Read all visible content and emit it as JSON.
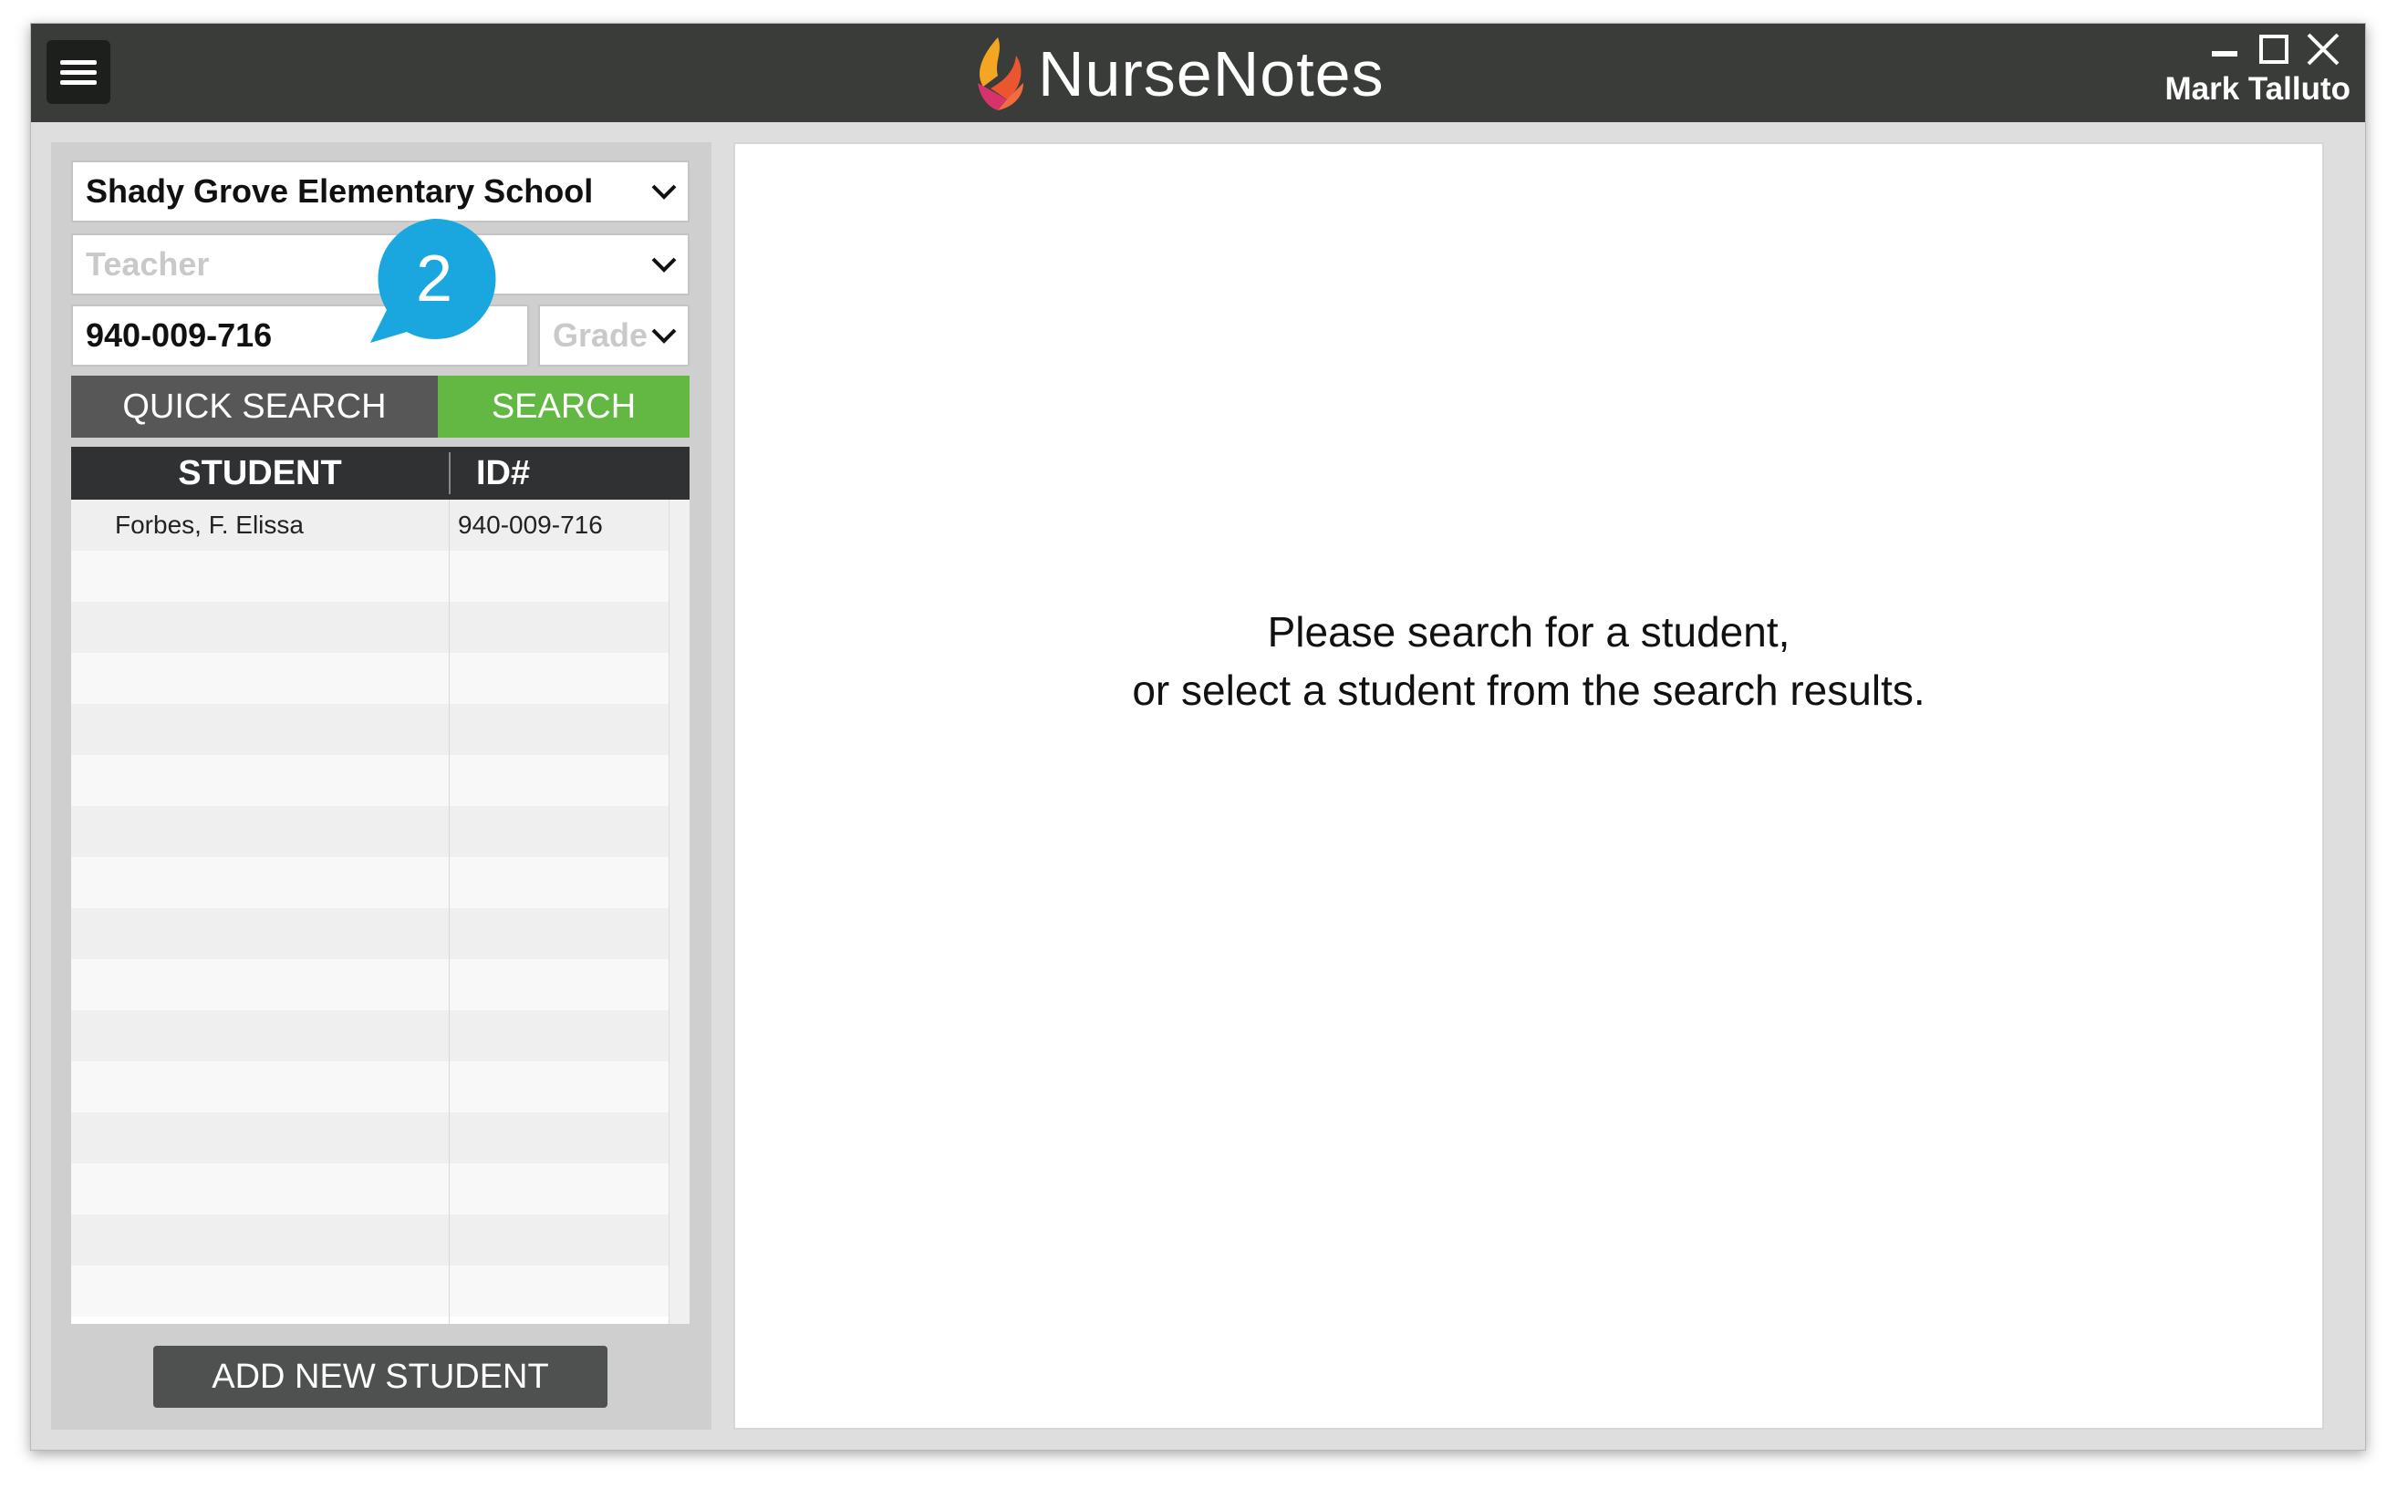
{
  "app": {
    "title": "NurseNotes",
    "user_name": "Mark Talluto"
  },
  "filters": {
    "school": "Shady Grove Elementary School",
    "teacher_placeholder": "Teacher",
    "id_value": "940-009-716",
    "grade_placeholder": "Grade"
  },
  "buttons": {
    "quick_search": "QUICK SEARCH",
    "search": "SEARCH",
    "add_new_student": "ADD NEW STUDENT"
  },
  "table": {
    "headers": {
      "student": "STUDENT",
      "id": "ID#"
    },
    "rows": [
      {
        "student": "Forbes, F. Elissa",
        "id": "940-009-716"
      }
    ]
  },
  "main": {
    "message_line1": "Please search for a student,",
    "message_line2": "or select a student from the search results."
  },
  "callout": {
    "number": "2"
  },
  "colors": {
    "titlebar": "#3a3c3a",
    "search_green": "#62b843",
    "callout_blue": "#1aa7e0"
  }
}
